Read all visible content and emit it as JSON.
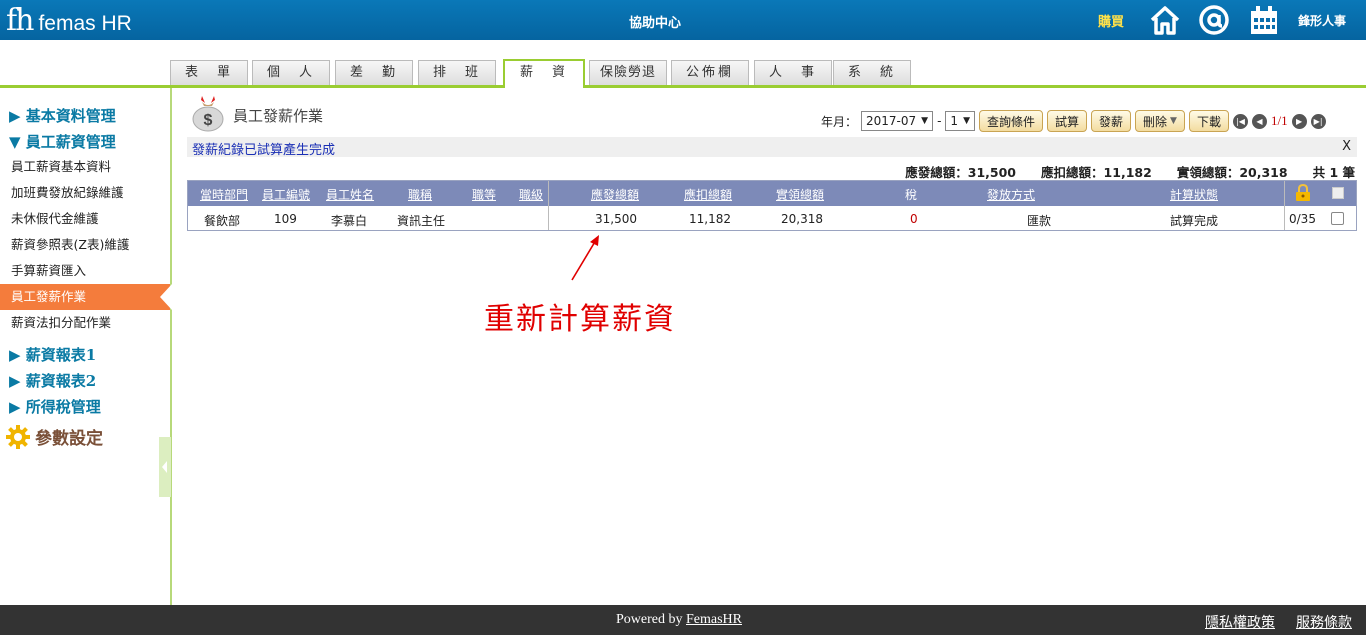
{
  "header": {
    "logo_mark": "fh",
    "logo_text": "femas HR",
    "help_center": "協助中心",
    "buy": "購買",
    "company": "鋒形人事",
    "icons": [
      "home-icon",
      "at-icon",
      "calendar-icon"
    ]
  },
  "tabs": [
    "表　單",
    "個　人",
    "差　勤",
    "排　班",
    "薪　資",
    "保險勞退",
    "公佈欄",
    "人　事",
    "系　統"
  ],
  "active_tab": "薪　資",
  "sidebar": {
    "groups": [
      {
        "label": "▶ 基本資料管理"
      },
      {
        "label": "▼ 員工薪資管理"
      },
      {
        "label": "▶ 薪資報表1"
      },
      {
        "label": "▶ 薪資報表2"
      },
      {
        "label": "▶ 所得稅管理"
      }
    ],
    "items": [
      {
        "label": "員工薪資基本資料"
      },
      {
        "label": "加班費發放紀錄維護"
      },
      {
        "label": "未休假代金維護"
      },
      {
        "label": "薪資參照表(Z表)維護"
      },
      {
        "label": "手算薪資匯入"
      },
      {
        "label": "員工發薪作業"
      },
      {
        "label": "薪資法扣分配作業"
      }
    ],
    "active_item": "員工發薪作業",
    "param": "參數設定"
  },
  "page": {
    "title": "員工發薪作業",
    "year_month_label": "年月：",
    "year_month_value": "2017-07",
    "dash": "-",
    "period_value": "1",
    "buttons": {
      "query": "查詢條件",
      "trial": "試算",
      "pay": "發薪",
      "delete": "刪除",
      "download": "下載"
    },
    "page_info": "1/1",
    "message": "發薪紀錄已試算產生完成",
    "message_close": "X",
    "totals": {
      "payable_label": "應發總額：",
      "payable_value": "31,500",
      "deduct_label": "應扣總額：",
      "deduct_value": "11,182",
      "net_label": "實領總額：",
      "net_value": "20,318",
      "count_text": "共 1 筆"
    }
  },
  "table": {
    "headers": {
      "dept": "當時部門",
      "emp_no": "員工編號",
      "emp_name": "員工姓名",
      "title": "職稱",
      "grade": "職等",
      "level": "職級",
      "payable": "應發總額",
      "deduct": "應扣總額",
      "net": "實領總額",
      "tax": "稅",
      "method": "發放方式",
      "status": "計算狀態"
    },
    "rows": [
      {
        "dept": "餐飲部",
        "emp_no": "109",
        "emp_name": "李慕白",
        "title": "資訊主任",
        "grade": "",
        "level": "",
        "payable": "31,500",
        "deduct": "11,182",
        "net": "20,318",
        "tax": "0",
        "method": "匯款",
        "status": "試算完成",
        "lock": "0/35"
      }
    ]
  },
  "annotation": "重新計算薪資",
  "footer": {
    "powered_prefix": "Powered by ",
    "powered_link": "FemasHR",
    "privacy": "隱私權政策",
    "terms": "服務條款"
  },
  "colors": {
    "header_blue": "#0a6ead",
    "accent_green": "#9acd32",
    "active_orange": "#f47c3c",
    "grid_header": "#7d8ab8",
    "annotation_red": "#e00000",
    "footer_dark": "#333333"
  }
}
